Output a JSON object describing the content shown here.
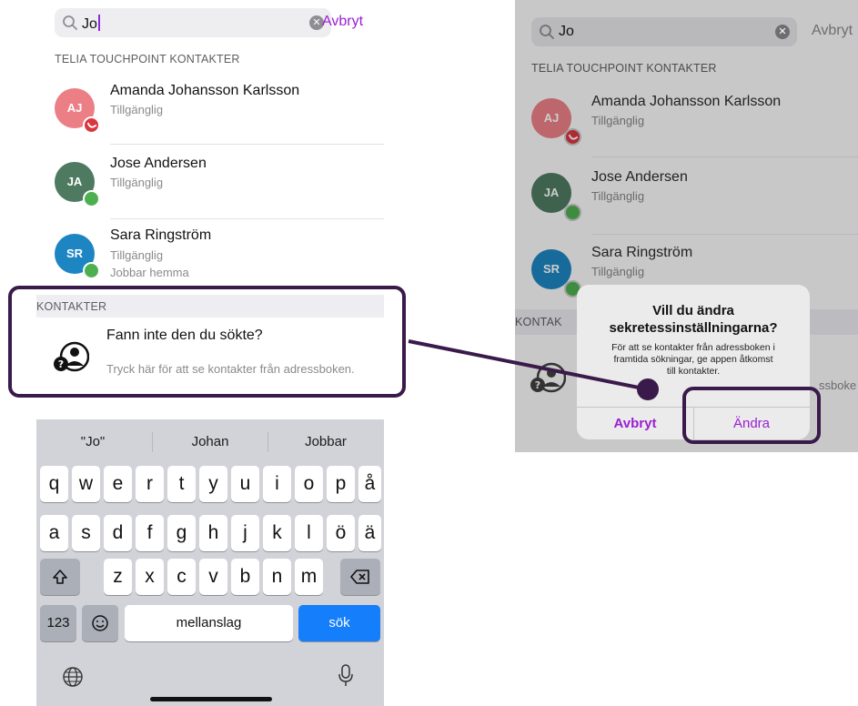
{
  "left": {
    "search": {
      "query": "Jo",
      "cancel_label": "Avbryt"
    },
    "sections": {
      "touchpoint": "TELIA TOUCHPOINT KONTAKTER",
      "contacts": "KONTAKTER"
    },
    "contacts": [
      {
        "initials": "AJ",
        "name": "Amanda Johansson Karlsson",
        "status": "Tillgänglig",
        "note": "",
        "avatar_color": "#ec7f86",
        "badge": "call"
      },
      {
        "initials": "JA",
        "name": "Jose Andersen",
        "status": "Tillgänglig",
        "note": "",
        "avatar_color": "#4d7a60",
        "badge": "available"
      },
      {
        "initials": "SR",
        "name": "Sara Ringström",
        "status": "Tillgänglig",
        "note": "Jobbar hemma",
        "avatar_color": "#1d86c2",
        "badge": "available"
      }
    ],
    "address_book": {
      "title": "Fann inte den du sökte?",
      "subtitle": "Tryck här för att se kontakter från adressboken."
    },
    "keyboard": {
      "suggestions": [
        "\"Jo\"",
        "Johan",
        "Jobbar"
      ],
      "row1": [
        "q",
        "w",
        "e",
        "r",
        "t",
        "y",
        "u",
        "i",
        "o",
        "p",
        "å"
      ],
      "row2": [
        "a",
        "s",
        "d",
        "f",
        "g",
        "h",
        "j",
        "k",
        "l",
        "ö",
        "ä"
      ],
      "row3": [
        "z",
        "x",
        "c",
        "v",
        "b",
        "n",
        "m"
      ],
      "numbers_label": "123",
      "space_label": "mellanslag",
      "search_label": "sök"
    }
  },
  "right": {
    "search": {
      "query": "Jo",
      "cancel_label": "Avbryt"
    },
    "sections": {
      "touchpoint": "TELIA TOUCHPOINT KONTAKTER",
      "contacts_partial": "KONTAK"
    },
    "contacts": [
      {
        "initials": "AJ",
        "name": "Amanda Johansson Karlsson",
        "status": "Tillgänglig"
      },
      {
        "initials": "JA",
        "name": "Jose Andersen",
        "status": "Tillgänglig"
      },
      {
        "initials": "SR",
        "name": "Sara Ringström",
        "status": "Tillgänglig"
      }
    ],
    "address_book_partial": "ssboke",
    "alert": {
      "title_line1": "Vill du ändra",
      "title_line2": "sekretessinställningarna?",
      "message_line1": "För att se kontakter från adressboken i",
      "message_line2": "framtida sökningar, ge appen åtkomst",
      "message_line3": "till kontakter.",
      "cancel_label": "Avbryt",
      "confirm_label": "Ändra"
    }
  },
  "colors": {
    "accent": "#9b1fd1",
    "highlight": "#3a1a4a",
    "available": "#4caf50",
    "busy": "#d9363e",
    "keyboard_blue": "#147efb"
  }
}
